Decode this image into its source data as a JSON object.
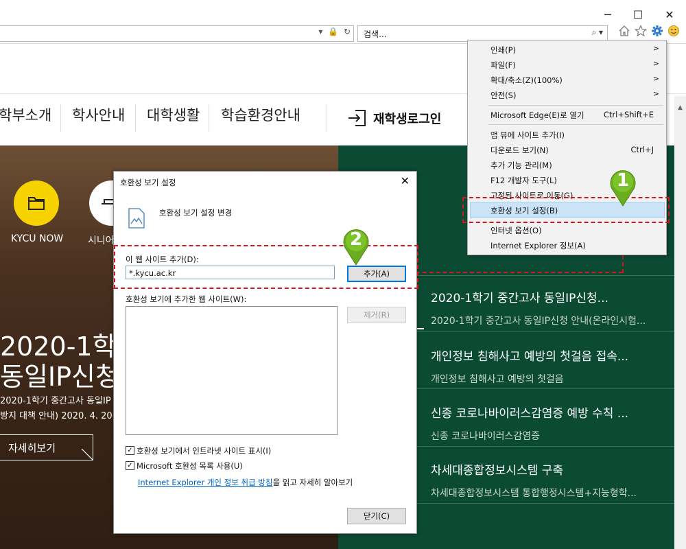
{
  "browser": {
    "window_controls": [
      "─",
      "☐",
      "✕"
    ],
    "address_icons": "▾ 🔒 ↻",
    "search": {
      "placeholder": "검색...",
      "icons": "⌕ ▾"
    },
    "toolbar_icons": [
      "home-icon",
      "star-icon",
      "gear-icon",
      "smiley-icon"
    ]
  },
  "site": {
    "nav": [
      "학부소개",
      "학사안내",
      "대학생활",
      "학습환경안내"
    ],
    "login": "재학생로그인",
    "quick_links": [
      {
        "label": "KYCU NOW",
        "icon": "folder-icon"
      },
      {
        "label": "시니어",
        "icon": "hat-icon"
      }
    ],
    "hero": {
      "title_line1": "2020-1학기",
      "title_line2": "동일IP신청",
      "sub_line1": "2020-1학기 중간고사 동일IP",
      "sub_line2": "방지 대책 안내) 2020. 4. 20(",
      "more": "자세히보기"
    },
    "news": [
      {
        "title": "2020-1학기 중간고사 동일IP신청...",
        "sub": "2020-1학기 중간고사 동일IP신청 안내(온라인시험..."
      },
      {
        "title": "개인정보 침해사고 예방의 첫걸음 접속...",
        "sub": "개인정보 침해사고 예방의 첫걸음"
      },
      {
        "title": "신종 코로나바이러스감염증 예방 수칙 ...",
        "sub": "신종 코로나바이러스감염증"
      },
      {
        "title": "차세대종합정보시스템 구축",
        "sub": "차세대종합정보시스템 통합행정시스템+지능형학..."
      }
    ]
  },
  "menu": {
    "items": [
      {
        "label": "인쇄(P)",
        "shortcut": "",
        "submenu": true
      },
      {
        "label": "파일(F)",
        "shortcut": "",
        "submenu": true
      },
      {
        "label": "확대/축소(Z)(100%)",
        "shortcut": "",
        "submenu": true
      },
      {
        "label": "안전(S)",
        "shortcut": "",
        "submenu": true
      },
      {
        "label": "Microsoft Edge(E)로 열기",
        "shortcut": "Ctrl+Shift+E",
        "submenu": false
      },
      {
        "label": "앱 뷰에 사이트 추가(I)",
        "shortcut": "",
        "submenu": false
      },
      {
        "label": "다운로드 보기(N)",
        "shortcut": "Ctrl+J",
        "submenu": false
      },
      {
        "label": "추가 기능 관리(M)",
        "shortcut": "",
        "submenu": false
      },
      {
        "label": "F12 개발자 도구(L)",
        "shortcut": "",
        "submenu": false
      },
      {
        "label": "고정된 사이트로 이동(G)",
        "shortcut": "",
        "submenu": false
      },
      {
        "label": "호환성 보기 설정(B)",
        "shortcut": "",
        "submenu": false
      },
      {
        "label": "인터넷 옵션(O)",
        "shortcut": "",
        "submenu": false
      },
      {
        "label": "Internet Explorer 정보(A)",
        "shortcut": "",
        "submenu": false
      }
    ],
    "highlighted": "호환성 보기 설정(B)"
  },
  "dialog": {
    "title": "호환성 보기 설정",
    "heading": "호환성 보기 설정 변경",
    "add_label": "이 웹 사이트 추가(D):",
    "add_value": "*.kycu.ac.kr",
    "add_button": "추가(A)",
    "list_label": "호환성 보기에 추가한 웹 사이트(W):",
    "remove_button": "제거(R)",
    "check1": "호환성 보기에서 인트라넷 사이트 표시(I)",
    "check2": "Microsoft 호환성 목록 사용(U)",
    "link_text": "Internet Explorer 개인 정보 취급 방침",
    "link_suffix": "을 읽고 자세히 알아보기",
    "close_button": "닫기(C)"
  },
  "annotations": {
    "step1": "1",
    "step2": "2",
    "accent": "#d8141d",
    "pin_color": "#6cad1f"
  },
  "colors": {
    "hero_green": "#0b4a33",
    "quick_yellow": "#f5d200",
    "menu_highlight": "#cbe3f7"
  }
}
